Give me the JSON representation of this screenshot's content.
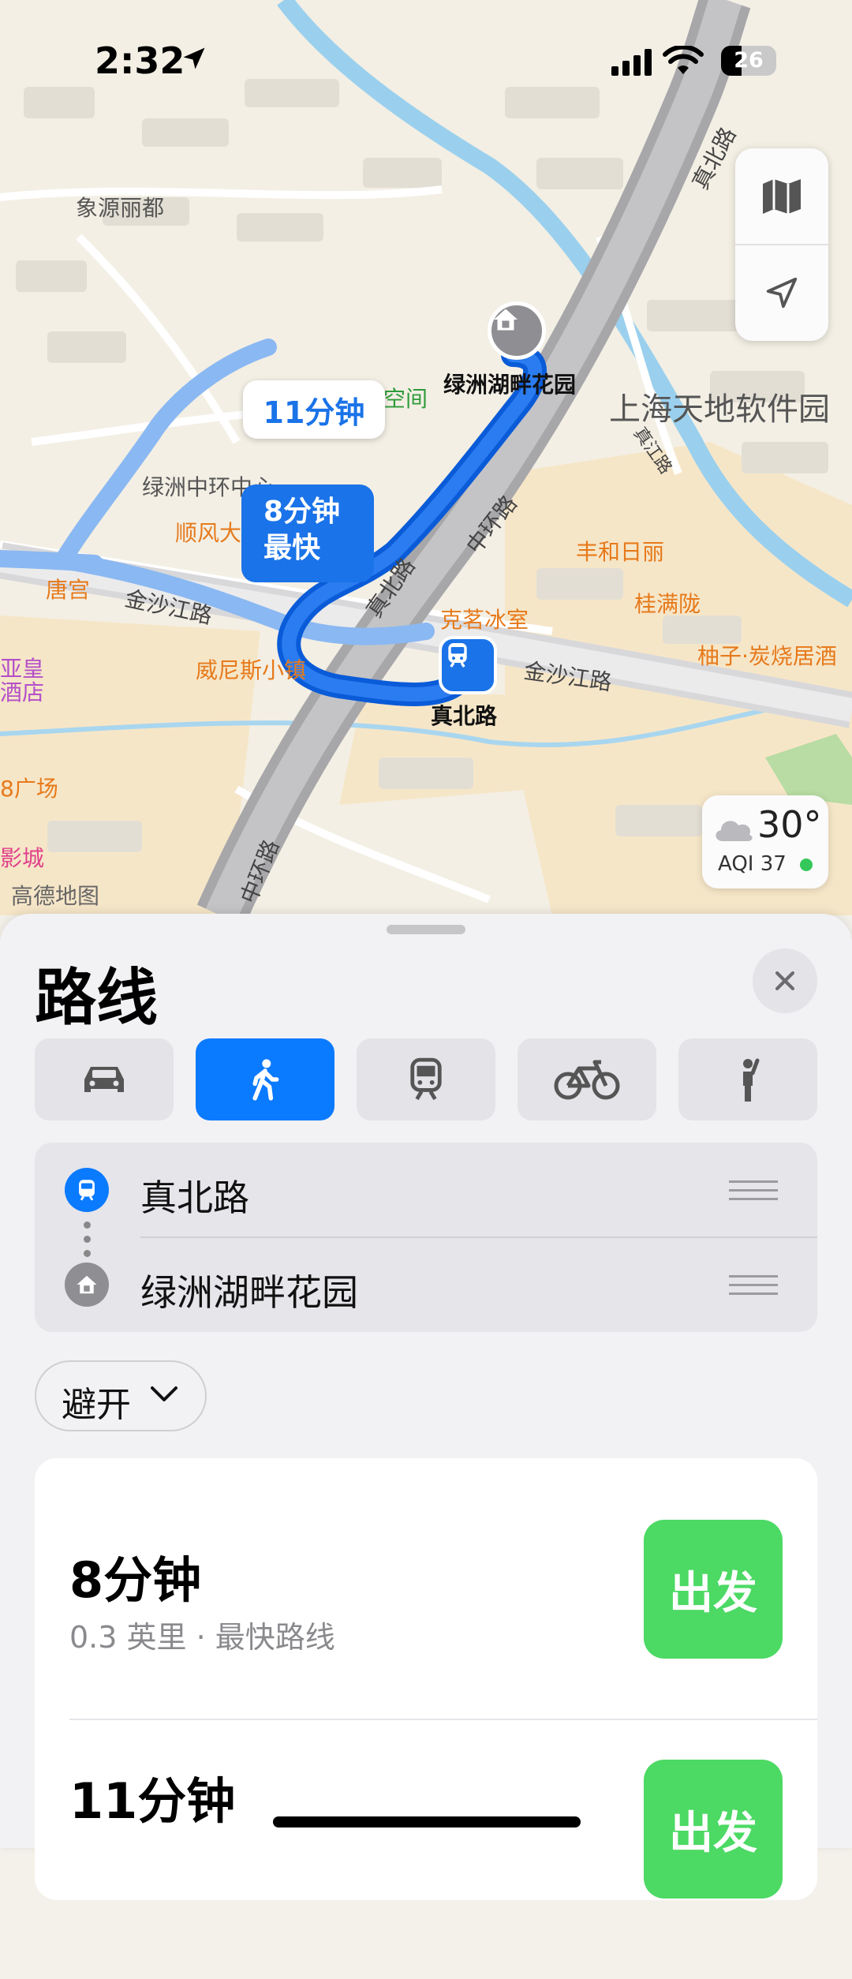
{
  "status_bar": {
    "time": "2:32",
    "battery": "26"
  },
  "map": {
    "labels": {
      "xiangyuan": "象源丽都",
      "home_name": "绿洲湖畔花园",
      "kongjian": "空间",
      "shanghai_tiandi": "上海天地软件园",
      "lvzhou_center": "绿洲中环中心",
      "shunfeng": "顺风大",
      "tanggong": "唐宫",
      "jinsha_road_left": "金沙江路",
      "jinsha_road_right": "金沙江路",
      "weinisi": "威尼斯小镇",
      "kemingbingshi": "克茗冰室",
      "fenghe": "丰和日丽",
      "guimanlong": "桂满陇",
      "youzi": "柚子·炭烧居酒",
      "station_name": "真北路",
      "zhenbei_top": "真北路",
      "zhenbei_mid": "真北路",
      "zhonghuan_mid": "中环路",
      "zhonghuan_bottom": "中环路",
      "zhenjiang": "真江路",
      "yahuang": "亚皇",
      "jiudian": "酒店",
      "guangchang": "8广场",
      "yingcheng": "影城"
    },
    "route_alt_time": "11分钟",
    "route_fast_time": "8分钟",
    "route_fast_tag": "最快",
    "weather": {
      "temp": "30°",
      "aqi": "AQI 37"
    },
    "attribution": "高德地图"
  },
  "sheet": {
    "title": "路线",
    "stops": [
      {
        "name": "真北路"
      },
      {
        "name": "绿洲湖畔花园"
      }
    ],
    "avoid_label": "避开",
    "routes": [
      {
        "duration": "8分钟",
        "meta": "0.3 英里 · 最快路线",
        "go": "出发"
      },
      {
        "duration": "11分钟",
        "go": "出发"
      }
    ]
  }
}
